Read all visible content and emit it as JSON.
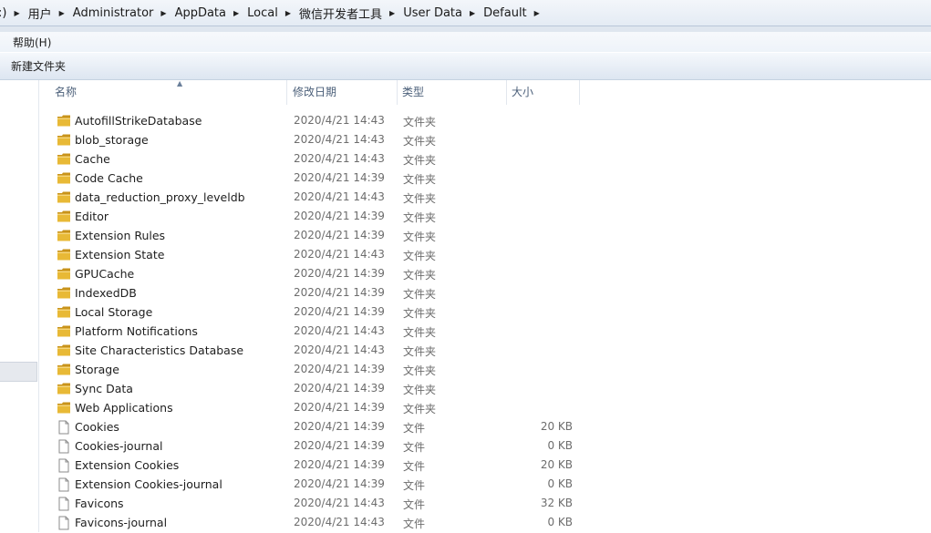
{
  "address": {
    "crumbs": [
      ":)",
      "用户",
      "Administrator",
      "AppData",
      "Local",
      "微信开发者工具",
      "User Data",
      "Default"
    ]
  },
  "menu": {
    "help": "帮助(H)"
  },
  "toolbar": {
    "new_folder": "新建文件夹"
  },
  "columns": {
    "name": "名称",
    "date": "修改日期",
    "type": "类型",
    "size": "大小"
  },
  "rows": [
    {
      "name": "AutofillStrikeDatabase",
      "date": "2020/4/21 14:43",
      "type": "文件夹",
      "size": "",
      "kind": "folder"
    },
    {
      "name": "blob_storage",
      "date": "2020/4/21 14:43",
      "type": "文件夹",
      "size": "",
      "kind": "folder"
    },
    {
      "name": "Cache",
      "date": "2020/4/21 14:43",
      "type": "文件夹",
      "size": "",
      "kind": "folder"
    },
    {
      "name": "Code Cache",
      "date": "2020/4/21 14:39",
      "type": "文件夹",
      "size": "",
      "kind": "folder"
    },
    {
      "name": "data_reduction_proxy_leveldb",
      "date": "2020/4/21 14:43",
      "type": "文件夹",
      "size": "",
      "kind": "folder"
    },
    {
      "name": "Editor",
      "date": "2020/4/21 14:39",
      "type": "文件夹",
      "size": "",
      "kind": "folder"
    },
    {
      "name": "Extension Rules",
      "date": "2020/4/21 14:39",
      "type": "文件夹",
      "size": "",
      "kind": "folder"
    },
    {
      "name": "Extension State",
      "date": "2020/4/21 14:43",
      "type": "文件夹",
      "size": "",
      "kind": "folder"
    },
    {
      "name": "GPUCache",
      "date": "2020/4/21 14:39",
      "type": "文件夹",
      "size": "",
      "kind": "folder"
    },
    {
      "name": "IndexedDB",
      "date": "2020/4/21 14:39",
      "type": "文件夹",
      "size": "",
      "kind": "folder"
    },
    {
      "name": "Local Storage",
      "date": "2020/4/21 14:39",
      "type": "文件夹",
      "size": "",
      "kind": "folder"
    },
    {
      "name": "Platform Notifications",
      "date": "2020/4/21 14:43",
      "type": "文件夹",
      "size": "",
      "kind": "folder"
    },
    {
      "name": "Site Characteristics Database",
      "date": "2020/4/21 14:43",
      "type": "文件夹",
      "size": "",
      "kind": "folder"
    },
    {
      "name": "Storage",
      "date": "2020/4/21 14:39",
      "type": "文件夹",
      "size": "",
      "kind": "folder"
    },
    {
      "name": "Sync Data",
      "date": "2020/4/21 14:39",
      "type": "文件夹",
      "size": "",
      "kind": "folder"
    },
    {
      "name": "Web Applications",
      "date": "2020/4/21 14:39",
      "type": "文件夹",
      "size": "",
      "kind": "folder"
    },
    {
      "name": "Cookies",
      "date": "2020/4/21 14:39",
      "type": "文件",
      "size": "20 KB",
      "kind": "file"
    },
    {
      "name": "Cookies-journal",
      "date": "2020/4/21 14:39",
      "type": "文件",
      "size": "0 KB",
      "kind": "file"
    },
    {
      "name": "Extension Cookies",
      "date": "2020/4/21 14:39",
      "type": "文件",
      "size": "20 KB",
      "kind": "file"
    },
    {
      "name": "Extension Cookies-journal",
      "date": "2020/4/21 14:39",
      "type": "文件",
      "size": "0 KB",
      "kind": "file"
    },
    {
      "name": "Favicons",
      "date": "2020/4/21 14:43",
      "type": "文件",
      "size": "32 KB",
      "kind": "file"
    },
    {
      "name": "Favicons-journal",
      "date": "2020/4/21 14:43",
      "type": "文件",
      "size": "0 KB",
      "kind": "file"
    }
  ],
  "colors": {
    "folder": "#e8b936",
    "folder_dark": "#c8931a",
    "header_text": "#4c607a"
  },
  "icons": {
    "folder": "folder-icon",
    "file": "file-icon",
    "separator": "chevron-right-icon"
  }
}
